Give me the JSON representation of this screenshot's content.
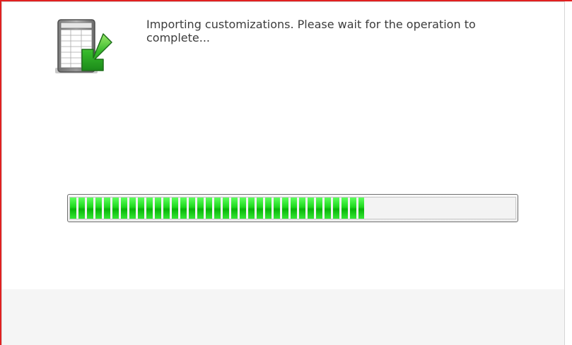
{
  "dialog": {
    "message": "Importing customizations. Please wait for the operation to\ncomplete...",
    "icon": "spreadsheet-import-icon",
    "progress_fraction": 0.66
  },
  "colors": {
    "progress_fill": "#22dd22",
    "frame_border": "#e02020",
    "footer_bg": "#f5f5f5",
    "text": "#3c3c3c"
  }
}
